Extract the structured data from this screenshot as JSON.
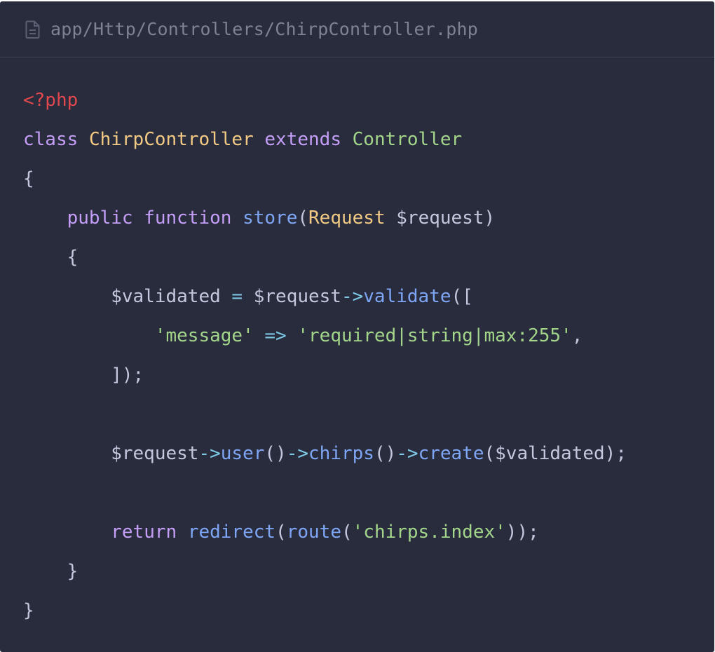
{
  "file": {
    "icon": "document-icon",
    "path": "app/Http/Controllers/ChirpController.php"
  },
  "colors": {
    "background": "#292c3d",
    "default_text": "#c3c8de",
    "php_tag": "#e0484e",
    "keyword": "#c49ef7",
    "class_name": "#f2ca84",
    "string": "#a3d68a",
    "function": "#7fa6f5",
    "operator": "#7dc8e4"
  },
  "code": {
    "lines": [
      [
        {
          "t": "<?php",
          "c": "tag"
        }
      ],
      [
        {
          "t": "class",
          "c": "kw"
        },
        {
          "t": " ",
          "c": "plain"
        },
        {
          "t": "ChirpController",
          "c": "cls"
        },
        {
          "t": " ",
          "c": "plain"
        },
        {
          "t": "extends",
          "c": "kw"
        },
        {
          "t": " ",
          "c": "plain"
        },
        {
          "t": "Controller",
          "c": "str"
        }
      ],
      [
        {
          "t": "{",
          "c": "plain"
        }
      ],
      [
        {
          "t": "    ",
          "c": "plain"
        },
        {
          "t": "public",
          "c": "kw"
        },
        {
          "t": " ",
          "c": "plain"
        },
        {
          "t": "function",
          "c": "kw"
        },
        {
          "t": " ",
          "c": "plain"
        },
        {
          "t": "store",
          "c": "fn"
        },
        {
          "t": "(",
          "c": "plain"
        },
        {
          "t": "Request",
          "c": "cls"
        },
        {
          "t": " $request)",
          "c": "plain"
        }
      ],
      [
        {
          "t": "    {",
          "c": "plain"
        }
      ],
      [
        {
          "t": "        $validated ",
          "c": "plain"
        },
        {
          "t": "=",
          "c": "op"
        },
        {
          "t": " $request",
          "c": "plain"
        },
        {
          "t": "->",
          "c": "op"
        },
        {
          "t": "validate",
          "c": "fn"
        },
        {
          "t": "([",
          "c": "plain"
        }
      ],
      [
        {
          "t": "            ",
          "c": "plain"
        },
        {
          "t": "'message'",
          "c": "str"
        },
        {
          "t": " ",
          "c": "plain"
        },
        {
          "t": "=>",
          "c": "op"
        },
        {
          "t": " ",
          "c": "plain"
        },
        {
          "t": "'required|string|max:255'",
          "c": "str"
        },
        {
          "t": ",",
          "c": "plain"
        }
      ],
      [
        {
          "t": "        ]);",
          "c": "plain"
        }
      ],
      [],
      [
        {
          "t": "        $request",
          "c": "plain"
        },
        {
          "t": "->",
          "c": "op"
        },
        {
          "t": "user",
          "c": "fn"
        },
        {
          "t": "()",
          "c": "plain"
        },
        {
          "t": "->",
          "c": "op"
        },
        {
          "t": "chirps",
          "c": "fn"
        },
        {
          "t": "()",
          "c": "plain"
        },
        {
          "t": "->",
          "c": "op"
        },
        {
          "t": "create",
          "c": "fn"
        },
        {
          "t": "($validated);",
          "c": "plain"
        }
      ],
      [],
      [
        {
          "t": "        ",
          "c": "plain"
        },
        {
          "t": "return",
          "c": "kw"
        },
        {
          "t": " ",
          "c": "plain"
        },
        {
          "t": "redirect",
          "c": "fn"
        },
        {
          "t": "(",
          "c": "plain"
        },
        {
          "t": "route",
          "c": "fn"
        },
        {
          "t": "(",
          "c": "plain"
        },
        {
          "t": "'chirps.index'",
          "c": "str"
        },
        {
          "t": "));",
          "c": "plain"
        }
      ],
      [
        {
          "t": "    }",
          "c": "plain"
        }
      ],
      [
        {
          "t": "}",
          "c": "plain"
        }
      ]
    ]
  }
}
